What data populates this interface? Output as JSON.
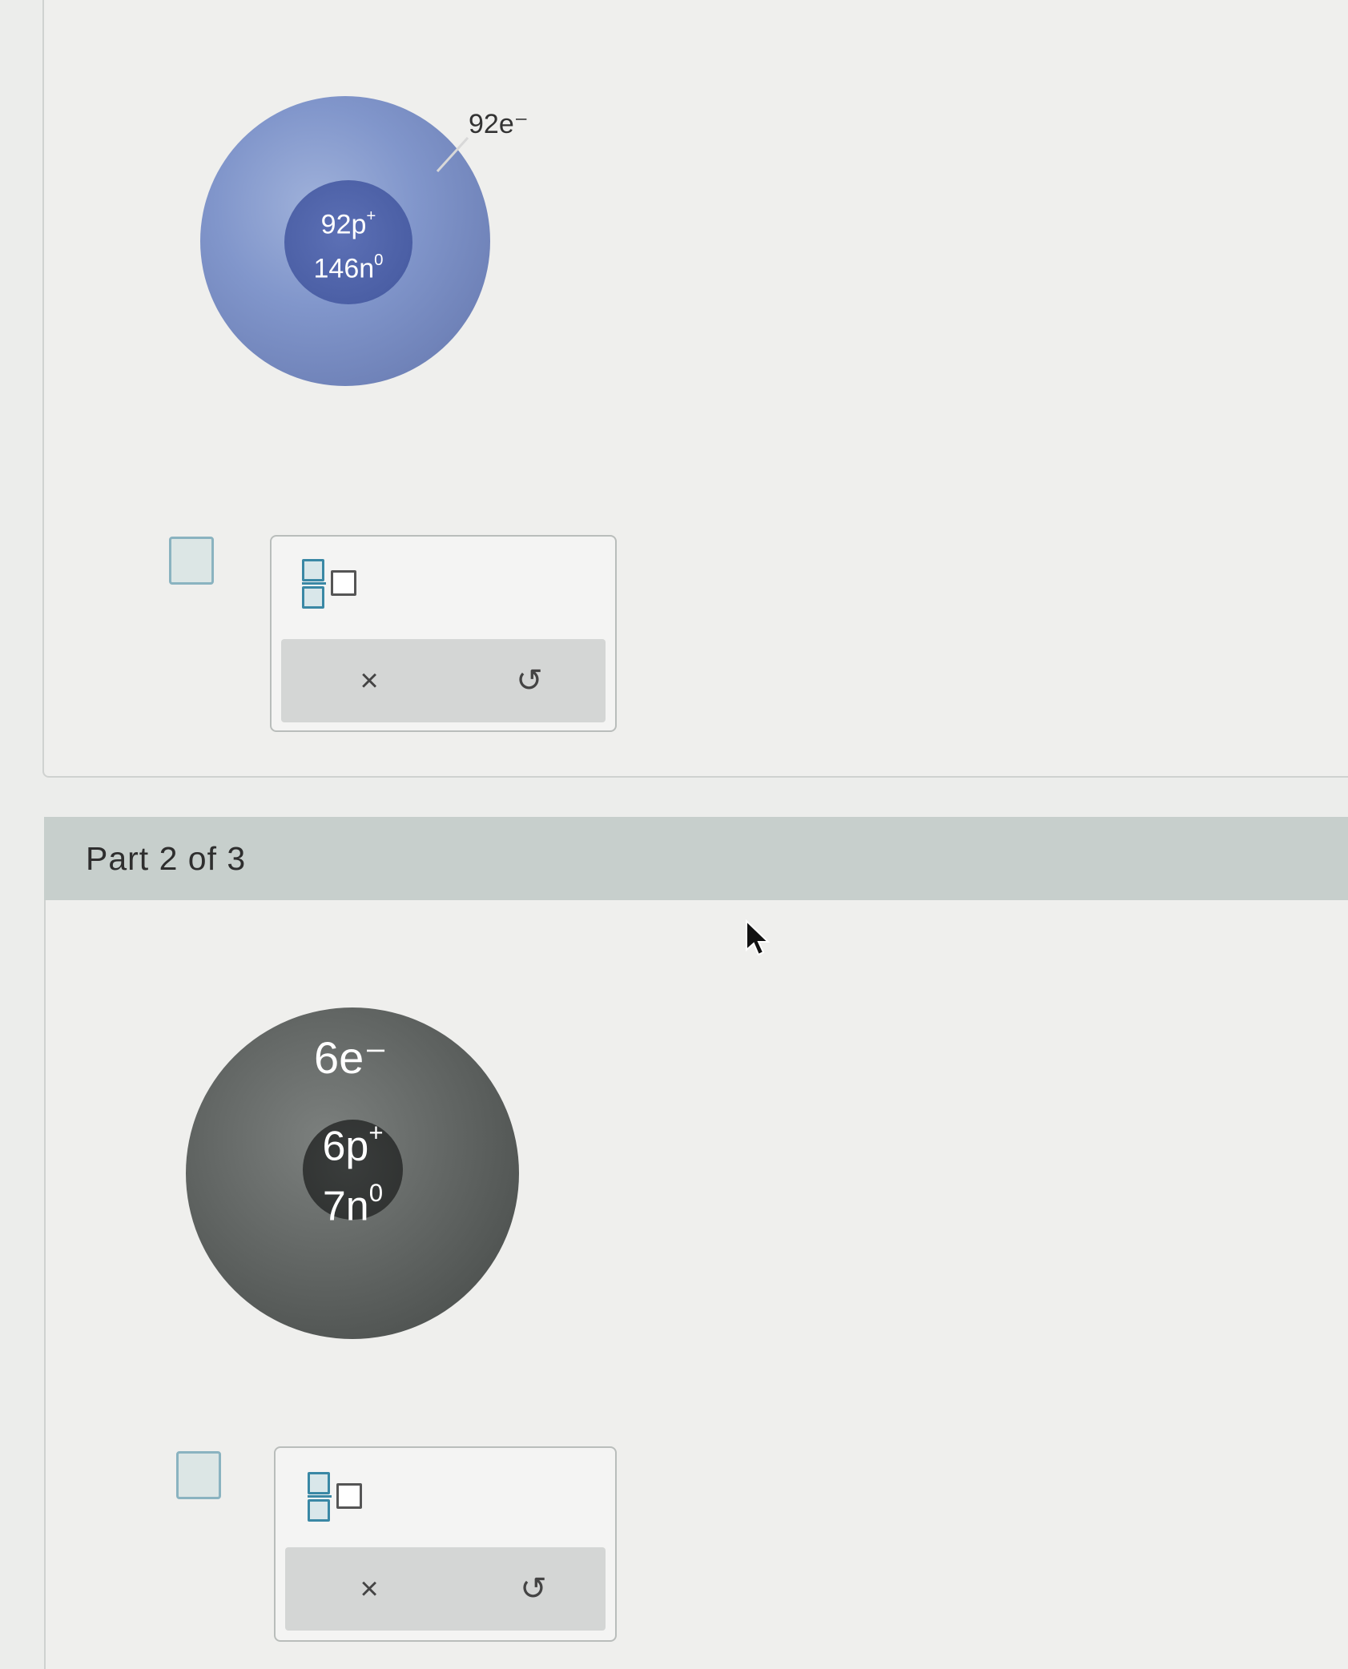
{
  "part1": {
    "atom": {
      "electron_label": "92e⁻",
      "nucleus_line1": "92p",
      "nucleus_line1_sup": "+",
      "nucleus_line2": "146n",
      "nucleus_line2_sup": "0"
    },
    "answer_widget": {
      "fraction_icon": "fraction-template-icon",
      "clear_label": "×",
      "undo_label": "↺"
    }
  },
  "part2": {
    "header": "Part 2 of 3",
    "atom": {
      "electron_label": "6e⁻",
      "nucleus_line1": "6p",
      "nucleus_line1_sup": "+",
      "nucleus_line2": "7n",
      "nucleus_line2_sup": "0"
    },
    "answer_widget": {
      "fraction_icon": "fraction-template-icon",
      "clear_label": "×",
      "undo_label": "↺"
    }
  },
  "colors": {
    "uranium_atom": "#8196cb",
    "carbon_atom": "#626664",
    "accent": "#3a88a5",
    "header_band": "#c7cfcc"
  }
}
